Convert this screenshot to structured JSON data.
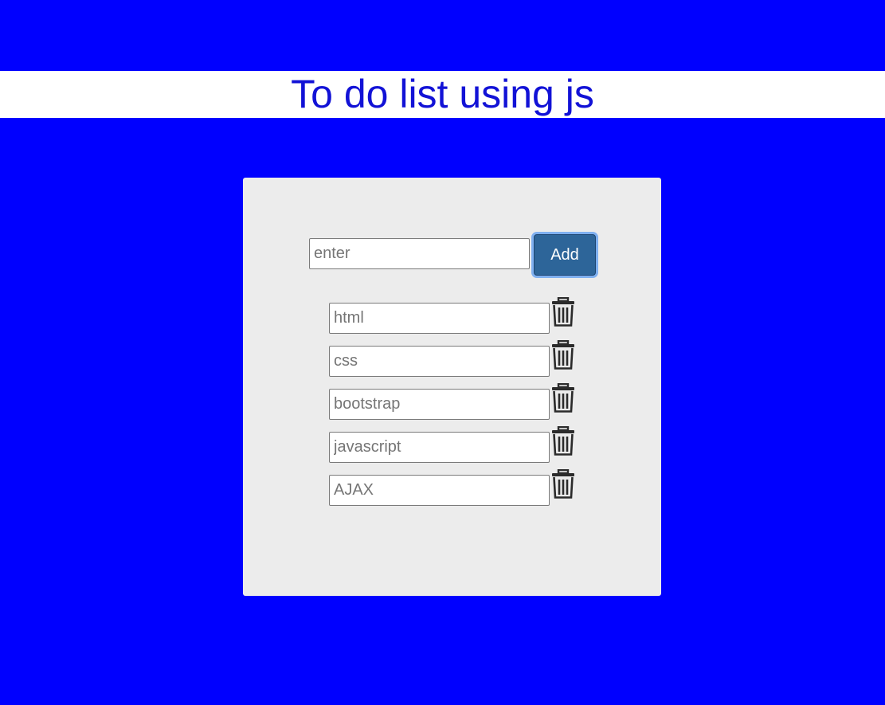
{
  "header": {
    "title": "To do list using js"
  },
  "add_form": {
    "placeholder": "enter",
    "button_label": "Add"
  },
  "todos": [
    {
      "placeholder": "html",
      "delete_icon": "trash-icon"
    },
    {
      "placeholder": "css",
      "delete_icon": "trash-icon"
    },
    {
      "placeholder": "bootstrap",
      "delete_icon": "trash-icon"
    },
    {
      "placeholder": "javascript",
      "delete_icon": "trash-icon"
    },
    {
      "placeholder": "AJAX",
      "delete_icon": "trash-icon"
    }
  ],
  "colors": {
    "background": "#0000ff",
    "title": "#1212d6",
    "card": "#ececec",
    "add_button": "#2d6599"
  }
}
